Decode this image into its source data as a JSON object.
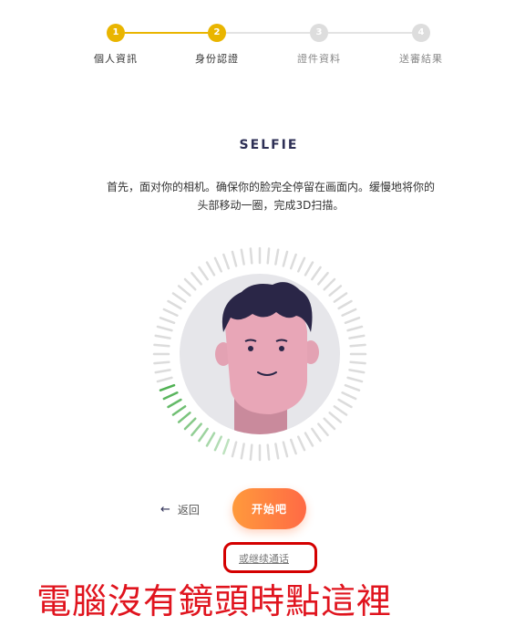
{
  "stepper": {
    "steps": [
      {
        "number": "1",
        "label": "個人資訊",
        "state": "done"
      },
      {
        "number": "2",
        "label": "身份認證",
        "state": "active"
      },
      {
        "number": "3",
        "label": "證件資料",
        "state": "pending"
      },
      {
        "number": "4",
        "label": "送審結果",
        "state": "pending"
      }
    ]
  },
  "title": "SELFIE",
  "description": "首先，面对你的相机。确保你的脸完全停留在画面内。缓慢地将你的头部移动一圈，完成3D扫描。",
  "scan_progress": 0.15,
  "back_label": "返回",
  "start_label": "开始吧",
  "continue_link": "或继续通话",
  "annotation": "電腦沒有鏡頭時點這裡",
  "colors": {
    "accent": "#e9b500",
    "progress": "#4caf50",
    "annotation": "#e0141e"
  }
}
